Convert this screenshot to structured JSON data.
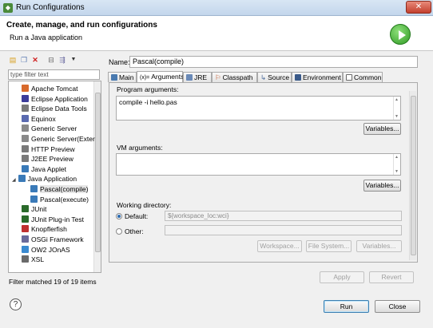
{
  "window": {
    "title": "Run Configurations"
  },
  "header": {
    "heading": "Create, manage, and run configurations",
    "subheading": "Run a Java application"
  },
  "left": {
    "filter_placeholder": "type filter text",
    "tree": [
      {
        "label": "Apache Tomcat",
        "icon": "tomcat-icon",
        "color": "#d86a2c"
      },
      {
        "label": "Eclipse Application",
        "icon": "eclipse-icon",
        "color": "#3b3b9a"
      },
      {
        "label": "Eclipse Data Tools",
        "icon": "data-tools-icon",
        "color": "#7a7a7a"
      },
      {
        "label": "Equinox",
        "icon": "equinox-icon",
        "color": "#5a6ab0"
      },
      {
        "label": "Generic Server",
        "icon": "server-icon",
        "color": "#8a8a8a"
      },
      {
        "label": "Generic Server(Exter",
        "icon": "server-icon",
        "color": "#8a8a8a"
      },
      {
        "label": "HTTP Preview",
        "icon": "http-icon",
        "color": "#7a7a7a"
      },
      {
        "label": "J2EE Preview",
        "icon": "j2ee-icon",
        "color": "#7a7a7a"
      },
      {
        "label": "Java Applet",
        "icon": "applet-icon",
        "color": "#3a7ab8"
      },
      {
        "label": "Java Application",
        "icon": "java-app-icon",
        "color": "#3a7ab8"
      },
      {
        "label": "Pascal(compile)",
        "icon": "java-app-icon",
        "color": "#3a7ab8"
      },
      {
        "label": "Pascal(execute)",
        "icon": "java-app-icon",
        "color": "#3a7ab8"
      },
      {
        "label": "JUnit",
        "icon": "junit-icon",
        "color": "#2a6a2a"
      },
      {
        "label": "JUnit Plug-in Test",
        "icon": "junit-plugin-icon",
        "color": "#2a6a2a"
      },
      {
        "label": "Knopflerfish",
        "icon": "knopflerfish-icon",
        "color": "#c03030"
      },
      {
        "label": "OSGi Framework",
        "icon": "osgi-icon",
        "color": "#6a6a9a"
      },
      {
        "label": "OW2 JOnAS",
        "icon": "jonas-icon",
        "color": "#3a8ad0"
      },
      {
        "label": "XSL",
        "icon": "xsl-icon",
        "color": "#6a6a6a"
      }
    ],
    "status": "Filter matched 19 of 19 items"
  },
  "config": {
    "name_label": "Name:",
    "name_value": "Pascal(compile)",
    "tabs": [
      "Main",
      "Arguments",
      "JRE",
      "Classpath",
      "Source",
      "Environment",
      "Common"
    ],
    "program_args_label": "Program arguments:",
    "program_args_value": "compile -i hello.pas",
    "vm_args_label": "VM arguments:",
    "vm_args_value": "",
    "variables_label": "Variables...",
    "working_dir_label": "Working directory:",
    "default_label": "Default:",
    "default_value": "${workspace_loc:wci}",
    "other_label": "Other:",
    "workspace_btn": "Workspace...",
    "filesystem_btn": "File System...",
    "variables_btn": "Variables..."
  },
  "actions": {
    "apply": "Apply",
    "revert": "Revert",
    "run": "Run",
    "close": "Close"
  }
}
